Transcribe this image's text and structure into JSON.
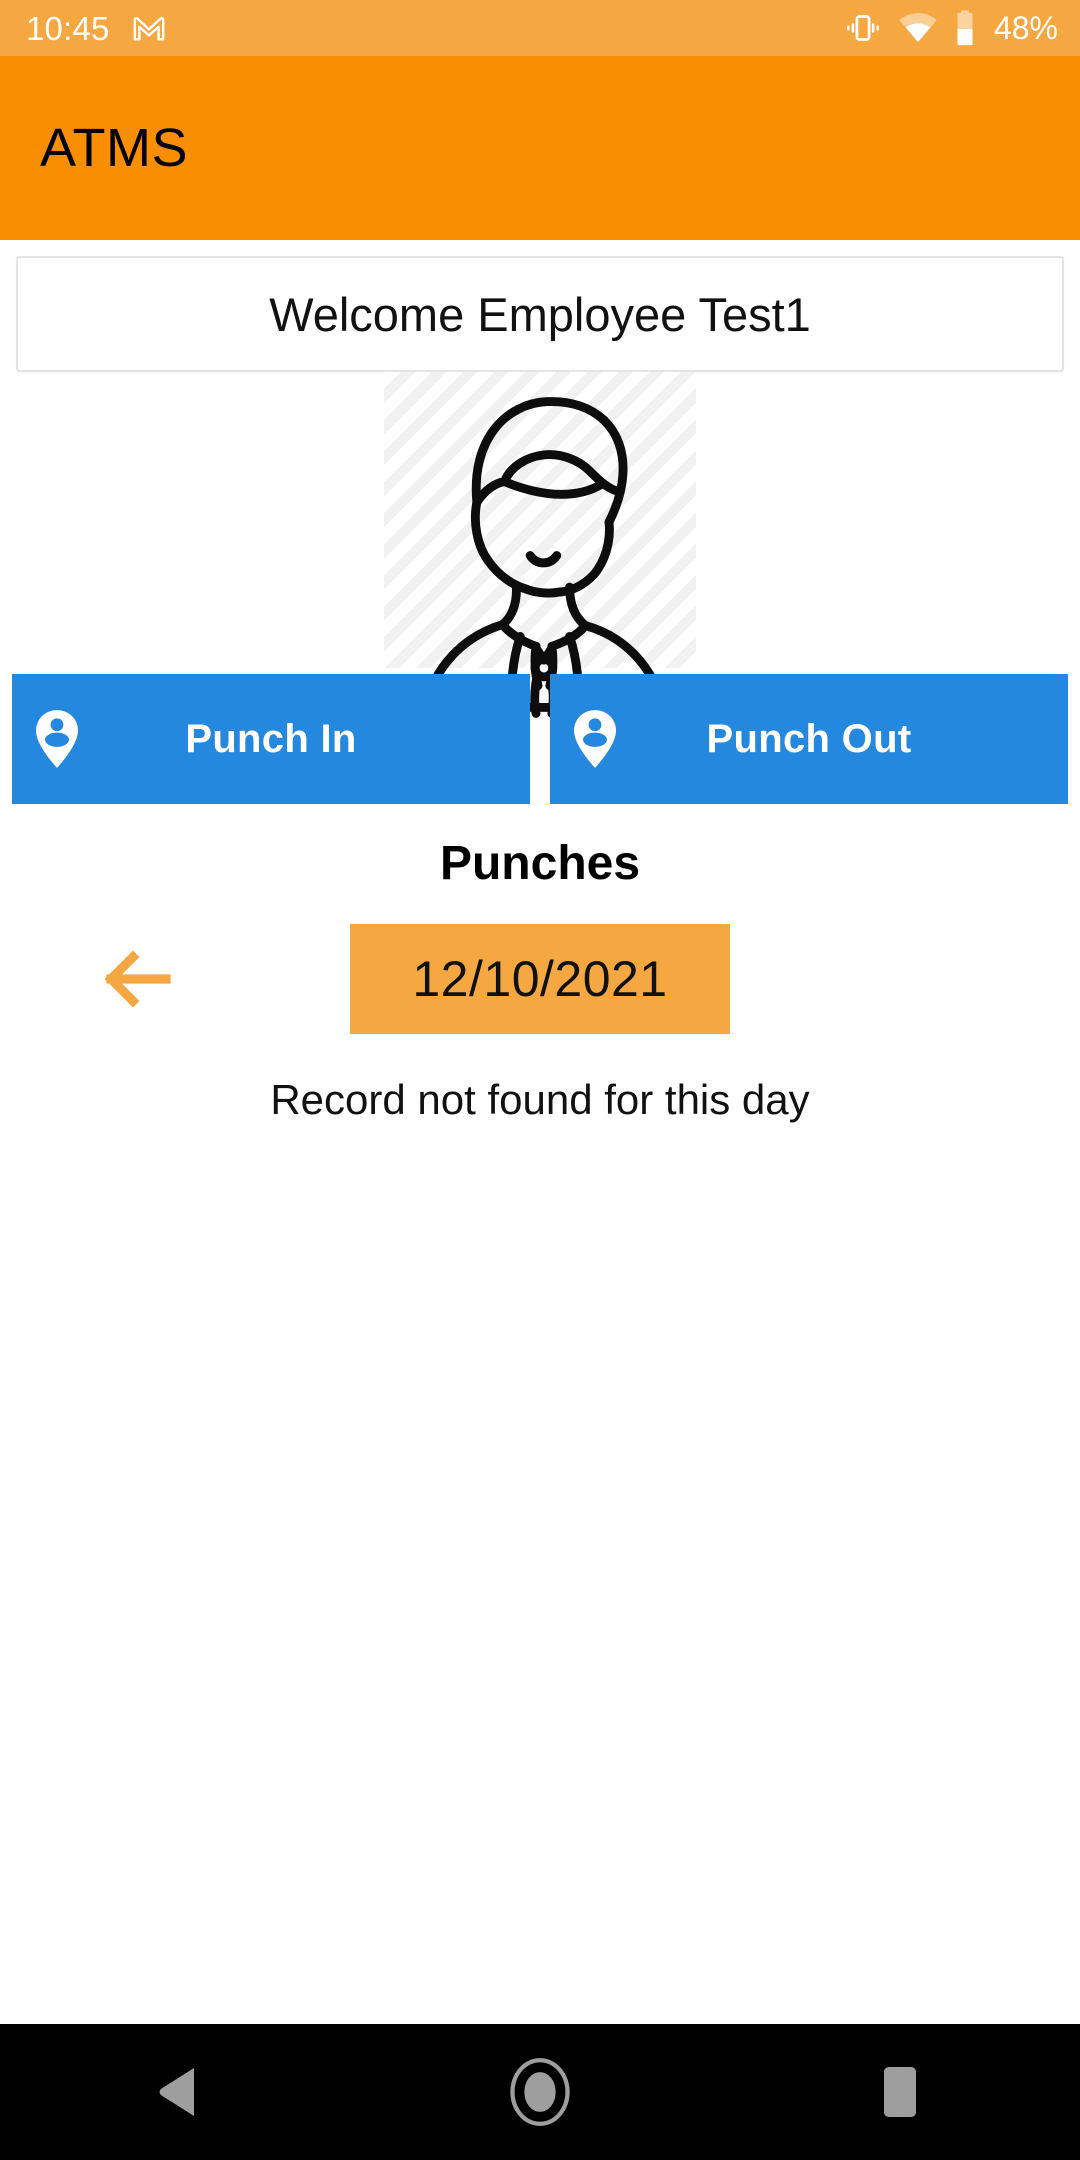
{
  "status_bar": {
    "time": "10:45",
    "notification_icon": "gmail-icon",
    "icons": [
      "vibrate-icon",
      "wifi-icon",
      "battery-icon"
    ],
    "battery_label": "48%",
    "battery_percent": 48,
    "background_color": "#F5A742",
    "foreground_color": "#FFFFFF"
  },
  "app_bar": {
    "title": "ATMS",
    "background_color": "#F98E02",
    "title_color": "#000000"
  },
  "welcome_card": {
    "text": "Welcome Employee Test1"
  },
  "avatar": {
    "icon_name": "employee-avatar-illustration"
  },
  "punch_buttons": [
    {
      "label": "Punch In",
      "icon": "location-person-pin-icon",
      "color": "#2488DE"
    },
    {
      "label": "Punch Out",
      "icon": "location-person-pin-icon",
      "color": "#2488DE"
    }
  ],
  "punches_section": {
    "heading": "Punches",
    "prev_day_icon": "arrow-left-icon",
    "prev_day_color": "#F5A742",
    "selected_date": "12/10/2021",
    "date_badge_color": "#F5A742",
    "empty_message": "Record not found for this day"
  },
  "nav_bar": {
    "background_color": "#000000",
    "buttons": [
      {
        "name": "back-button",
        "icon": "triangle-back-icon"
      },
      {
        "name": "home-button",
        "icon": "circle-home-icon"
      },
      {
        "name": "recents-button",
        "icon": "square-recents-icon"
      }
    ]
  }
}
